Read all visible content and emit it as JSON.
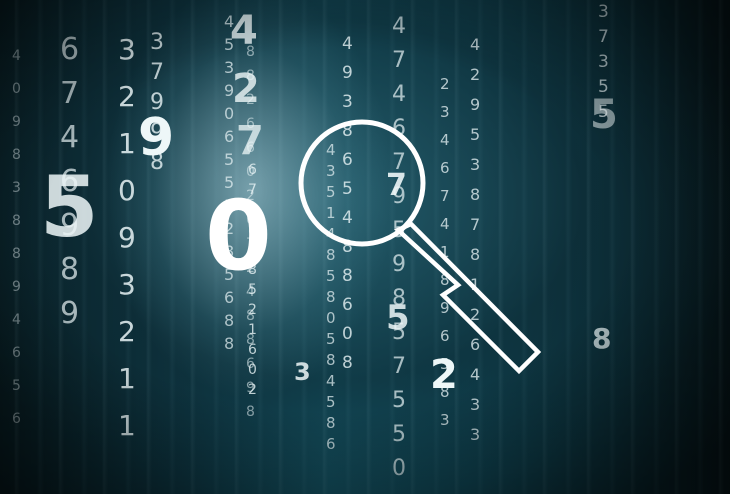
{
  "big_digits": [
    "5",
    "0",
    "9",
    "4",
    "2",
    "7",
    "7",
    "5",
    "2",
    "3",
    "8",
    "5"
  ],
  "columns": [
    [
      "6",
      "7",
      "4",
      "6",
      "9",
      "8",
      "9"
    ],
    [
      "3",
      "2",
      "1",
      "0",
      "9",
      "3",
      "2",
      "1",
      "1"
    ],
    [
      "3",
      "7",
      "9",
      "9",
      "8"
    ],
    [
      "4",
      "5",
      "3",
      "9",
      "0",
      "6",
      "5",
      "5",
      "5",
      "2",
      "8",
      "5",
      "6",
      "8",
      "8"
    ],
    [
      "6",
      "7",
      "1",
      "8",
      "4",
      "8",
      "5",
      "2",
      "1",
      "6",
      "0",
      "2"
    ],
    [
      "8",
      "8",
      "2",
      "6",
      "6",
      "0",
      "2",
      "6",
      "7",
      "2",
      "4",
      "8",
      "8",
      "6",
      "9",
      "8"
    ],
    [
      "4",
      "3",
      "5",
      "1",
      "4",
      "8",
      "5",
      "8",
      "0",
      "5",
      "8",
      "4",
      "5",
      "8",
      "6"
    ],
    [
      "4",
      "9",
      "3",
      "8",
      "6",
      "5",
      "4",
      "8",
      "8",
      "6",
      "0",
      "8"
    ],
    [
      "4",
      "7",
      "4",
      "6",
      "7",
      "9",
      "5",
      "9",
      "8",
      "5",
      "7",
      "5",
      "5",
      "0"
    ],
    [
      "2",
      "3",
      "4",
      "6",
      "7",
      "4",
      "1",
      "8",
      "9",
      "6",
      "5",
      "8",
      "3"
    ],
    [
      "4",
      "2",
      "9",
      "5",
      "3",
      "8",
      "7",
      "8",
      "1",
      "2",
      "6",
      "4",
      "3",
      "3"
    ],
    [
      "4",
      "0",
      "9",
      "8",
      "3",
      "8",
      "8",
      "9",
      "4",
      "6",
      "5",
      "6"
    ],
    [
      "3",
      "7",
      "3",
      "5",
      "5"
    ]
  ]
}
